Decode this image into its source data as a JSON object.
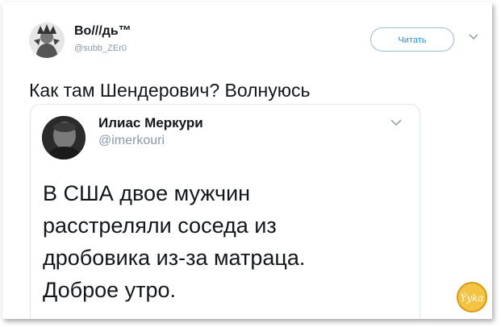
{
  "header": {
    "name": "Во///дь™",
    "handle": "@subb_ZEr0",
    "follow_label": "Читать"
  },
  "tweet": {
    "text": "Как там Шендерович? Волнуюсь"
  },
  "quoted": {
    "name": "Илиас Меркури",
    "handle": "@imerkouri",
    "lines": [
      "В США двое мужчин",
      "расстреляли соседа из",
      "дробовика из-за матраца.",
      "Доброе утро."
    ]
  },
  "watermark": {
    "text": "Ýyka"
  },
  "colors": {
    "accent": "#1b95e0",
    "text": "#14171a",
    "muted": "#8899a6",
    "border": "#e1e8ed",
    "watermark": "#e8b020"
  }
}
